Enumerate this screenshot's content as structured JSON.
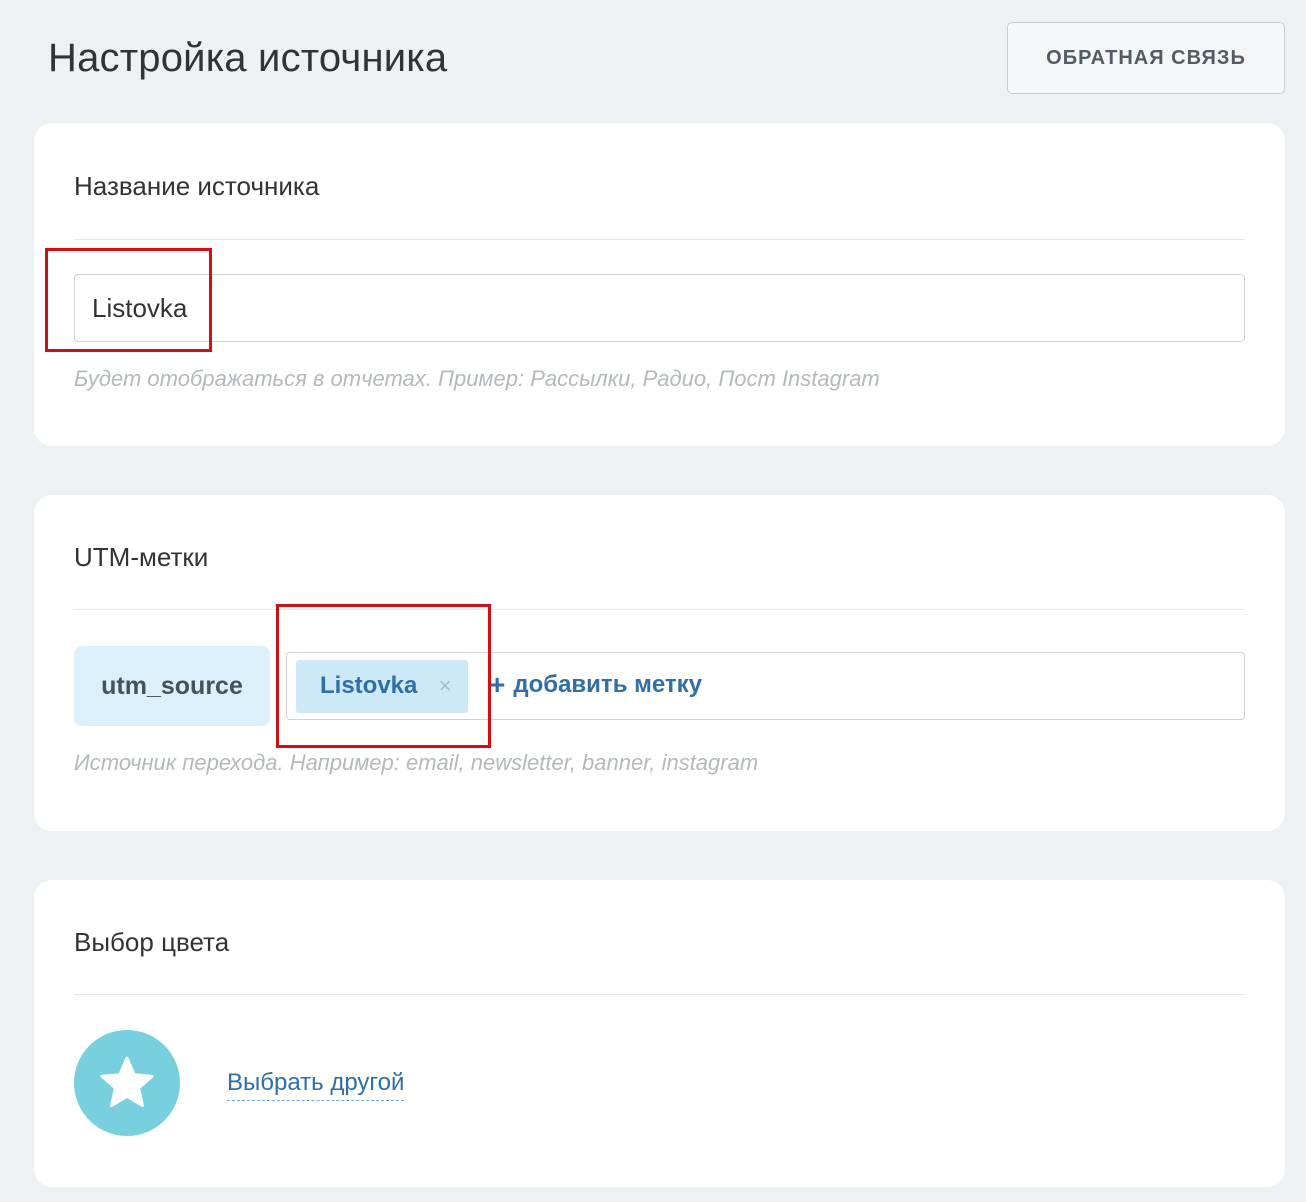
{
  "header": {
    "title": "Настройка источника",
    "feedback_label": "ОБРАТНАЯ СВЯЗЬ"
  },
  "source_name": {
    "title": "Название источника",
    "value": "Listovka",
    "hint": "Будет отображаться в отчетах. Пример: Рассылки, Радио, Пост Instagram"
  },
  "utm": {
    "title": "UTM-метки",
    "param_label": "utm_source",
    "tags": [
      {
        "label": "Listovka",
        "remove_glyph": "×"
      }
    ],
    "add_plus": "+",
    "add_label": "добавить метку",
    "hint": "Источник перехода. Например: email, newsletter, banner, instagram"
  },
  "color": {
    "title": "Выбор цвета",
    "selected_color": "#78cfde",
    "icon": "star-icon",
    "pick_other_label": "Выбрать другой"
  },
  "annotations": {
    "highlight_color": "#d40f14"
  }
}
